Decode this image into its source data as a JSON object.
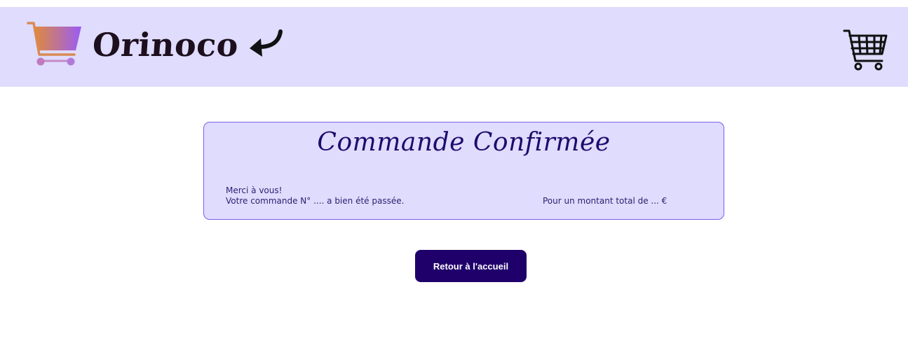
{
  "header": {
    "brand_name": "Orinoco",
    "logo_icon": "shopping-cart-gradient-icon",
    "back_icon": "curved-back-arrow-icon",
    "cart_icon": "shopping-cart-icon",
    "background_color": "#dfdcfd",
    "logo_gradient": [
      "#e08a3c",
      "#9a5cf5"
    ]
  },
  "confirmation": {
    "title": "Commande Confirmée",
    "thanks": "Merci à vous!",
    "order_line": "Votre commande N° .... a bien été passée.",
    "total_line": "Pour un montant total de ... €",
    "background_color": "#dfdcfd",
    "border_color": "#7b61e8",
    "title_color": "#1f0a6e"
  },
  "actions": {
    "home_button_label": "Retour à l'accueil",
    "home_button_color": "#1f006b"
  }
}
